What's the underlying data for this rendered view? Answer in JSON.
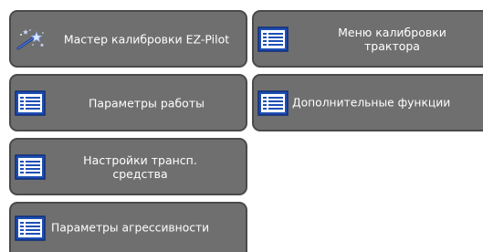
{
  "menu": {
    "items": [
      {
        "label": "Мастер калибровки EZ-Pilot",
        "icon": "wizard-wand-icon"
      },
      {
        "label": "Меню калибровки трактора",
        "icon": "list-icon"
      },
      {
        "label": "Параметры работы",
        "icon": "list-icon"
      },
      {
        "label": "Дополнительные функции",
        "icon": "list-icon"
      },
      {
        "label": "Настройки трансп. средства",
        "icon": "list-icon"
      },
      {
        "label": "Параметры агрессивности",
        "icon": "list-icon"
      }
    ]
  },
  "colors": {
    "tile_bg": "#6f6f6f",
    "tile_border": "#4a4a4a",
    "icon_blue": "#1e4fb5",
    "text": "#ffffff"
  }
}
